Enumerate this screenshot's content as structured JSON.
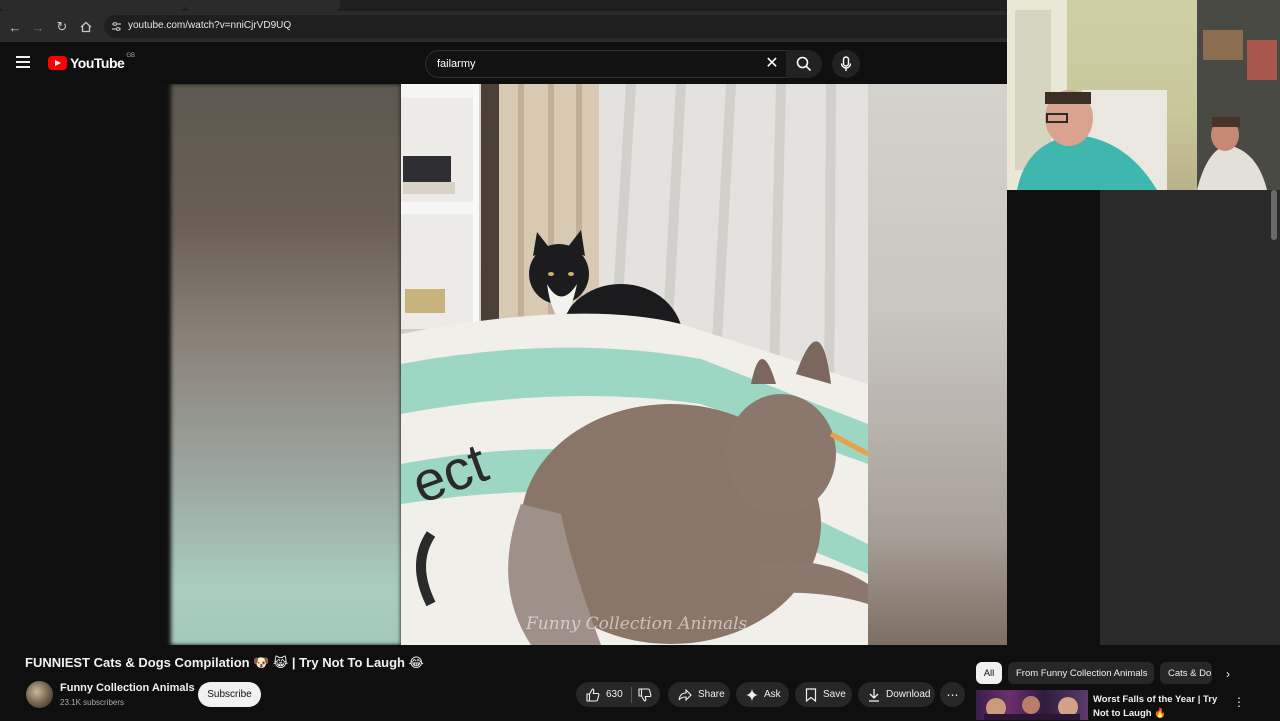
{
  "browser": {
    "url": "youtube.com/watch?v=nniCjrVD9UQ"
  },
  "header": {
    "logo_text": "YouTube",
    "country_code": "GB",
    "search_value": "failarmy"
  },
  "player": {
    "watermark": "Funny Collection Animals"
  },
  "video": {
    "title": "FUNNIEST Cats & Dogs Compilation 🐶 😹 | Try Not To Laugh 😂",
    "channel_name": "Funny Collection Animals",
    "subscribers": "23.1K subscribers",
    "subscribe_label": "Subscribe",
    "like_count": "630",
    "share_label": "Share",
    "ask_label": "Ask",
    "save_label": "Save",
    "download_label": "Download"
  },
  "sidebar": {
    "chips": [
      "All",
      "From Funny Collection Animals",
      "Cats & Do"
    ],
    "recommended": [
      {
        "title": "Worst Falls of the Year | Try Not to Laugh 🔥"
      }
    ]
  },
  "colors": {
    "accent": "#ff0000",
    "background": "#0f0f0f",
    "chip": "#272727"
  }
}
